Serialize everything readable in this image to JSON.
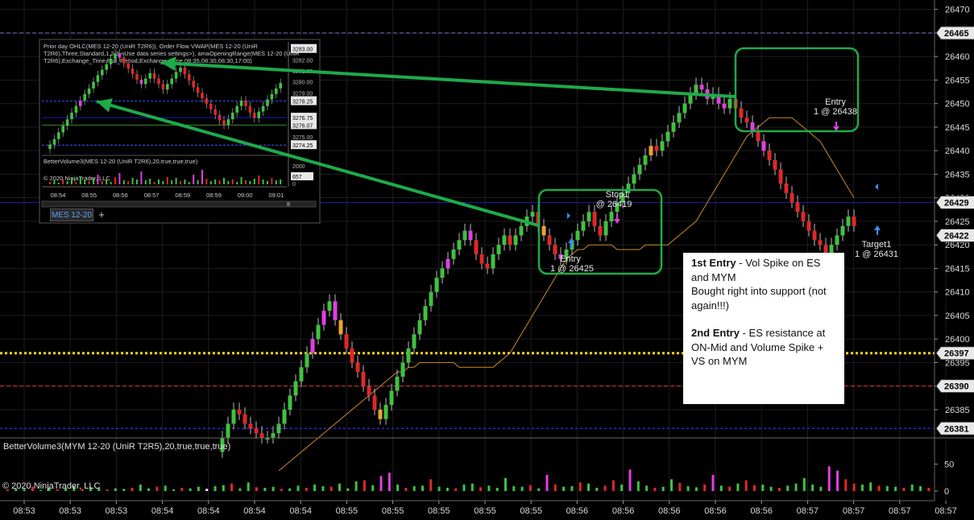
{
  "chart_data": [
    {
      "type": "candlestick",
      "instrument": "MYM 12-20",
      "price_axis": {
        "ylim": [
          26379,
          26472
        ],
        "ticks": [
          26385,
          26390,
          26395,
          26400,
          26405,
          26410,
          26415,
          26420,
          26425,
          26430,
          26435,
          26440,
          26445,
          26450,
          26455,
          26460,
          26465,
          26470
        ],
        "tick_labels": [
          "26385",
          "26390",
          "26395",
          "26400",
          "26405",
          "26410",
          "26415",
          "26420",
          "26425",
          "26430",
          "26435",
          "26440",
          "26445",
          "26450",
          "26455",
          "26460",
          "26465",
          "26470"
        ],
        "boxed_labels": [
          {
            "value": 26465,
            "text": "26465"
          },
          {
            "value": 26429,
            "text": "26429"
          },
          {
            "value": 26422,
            "text": "26422"
          },
          {
            "value": 26397,
            "text": "26397"
          },
          {
            "value": 26390,
            "text": "26390"
          },
          {
            "value": 26381,
            "text": "26381"
          }
        ]
      },
      "time_axis": {
        "labels": [
          "08:53",
          "08:53",
          "08:53",
          "08:54",
          "08:54",
          "08:54",
          "08:54",
          "08:55",
          "08:55",
          "08:55",
          "08:55",
          "08:55",
          "08:56",
          "08:56",
          "08:56",
          "08:56",
          "08:56",
          "08:57",
          "08:57",
          "08:57",
          "08:57"
        ]
      },
      "horizontal_lines": [
        {
          "value": 26465,
          "color": "#8a6fd8",
          "style": "dashed"
        },
        {
          "value": 26429,
          "color": "#1c1c9c",
          "style": "solid"
        },
        {
          "value": 26397,
          "color": "#ffd21e",
          "style": "dotted"
        },
        {
          "value": 26390,
          "color": "#e0303a",
          "style": "dashed"
        },
        {
          "value": 26381,
          "color": "#2a2ad0",
          "style": "dotted"
        }
      ],
      "closes": [
        26379,
        26382,
        26385,
        26384,
        26382,
        26381,
        26380,
        26379,
        26379,
        26380,
        26382,
        26385,
        26388,
        26391,
        26394,
        26397,
        26400,
        26403,
        26406,
        26408,
        26404,
        26401,
        26398,
        26395,
        26393,
        26390,
        26388,
        26385,
        26383,
        26386,
        26389,
        26392,
        26395,
        26398,
        26401,
        26404,
        26407,
        26410,
        26413,
        26415,
        26417,
        26419,
        26421,
        26423,
        26421,
        26418,
        26416,
        26415,
        26418,
        26420,
        26422,
        26420,
        26422,
        26424,
        26426,
        26427,
        26424,
        26422,
        26420,
        26418,
        26417,
        26419,
        26421,
        26423,
        26425,
        26427,
        26424,
        26422,
        26425,
        26427,
        26429,
        26431,
        26433,
        26435,
        26437,
        26439,
        26441,
        26440,
        26442,
        26444,
        26446,
        26448,
        26450,
        26452,
        26454,
        26453,
        26451,
        26452,
        26450,
        26449,
        26451,
        26449,
        26447,
        26446,
        26444,
        26442,
        26440,
        26438,
        26436,
        26433,
        26431,
        26429,
        26427,
        26425,
        26423,
        26421,
        26420,
        26418,
        26420,
        26422,
        26424,
        26426,
        26424
      ],
      "bar_colors_note": "green up, red down, magenta/orange volume-spike bars",
      "bar_special": {
        "16": "magenta",
        "18": "magenta",
        "20": "magenta",
        "21": "orange",
        "28": "orange",
        "40": "magenta",
        "44": "magenta",
        "57": "orange",
        "60": "magenta",
        "76": "orange",
        "85": "magenta",
        "86": "magenta",
        "88": "magenta",
        "89": "magenta",
        "94": "magenta",
        "96": "magenta"
      },
      "vwap": [
        26372,
        26373,
        26374,
        26375,
        26376,
        26377,
        26378,
        26379,
        26380,
        26381,
        26382,
        26383,
        26384,
        26385,
        26386,
        26387,
        26388,
        26389,
        26390,
        26391,
        26392,
        26393,
        26393,
        26394,
        26394,
        26395,
        26395,
        26395,
        26395,
        26395,
        26395,
        26395,
        26394,
        26394,
        26394,
        26394,
        26394,
        26394,
        26394,
        26395,
        26396,
        26397,
        26399,
        26401,
        26403,
        26405,
        26407,
        26409,
        26411,
        26413,
        26415,
        26417,
        26418,
        26419,
        26419,
        26420,
        26420,
        26420,
        26420,
        26420,
        26419,
        26419,
        26419,
        26419,
        26419,
        26420,
        26420,
        26420,
        26420,
        26420,
        26421,
        26422,
        26423,
        26424,
        26425,
        26427,
        26429,
        26431,
        26433,
        26435,
        26437,
        26439,
        26441,
        26443,
        26444,
        26445,
        26446,
        26447,
        26447,
        26447,
        26447,
        26447,
        26446,
        26445,
        26444,
        26443,
        26442,
        26440,
        26438,
        26436,
        26434,
        26432,
        26430
      ],
      "annotations": [
        {
          "kind": "text",
          "text": "Stop1",
          "price": 26421
        },
        {
          "kind": "text",
          "text": "@ 26419",
          "price": 26419
        },
        {
          "kind": "text",
          "text": "Entry",
          "price": 26416
        },
        {
          "kind": "text",
          "text": "1 @ 26425",
          "price": 26414
        },
        {
          "kind": "text",
          "text": "Entry",
          "price": 26450
        },
        {
          "kind": "text",
          "text": "1 @ 26438",
          "price": 26448
        },
        {
          "kind": "text",
          "text": "Target1",
          "price": 26419
        },
        {
          "kind": "text",
          "text": "1 @ 26431",
          "price": 26417
        }
      ],
      "highlight_color": "#1faa4a",
      "arrow_color": "#1faa4a"
    },
    {
      "type": "bar",
      "title": "BetterVolume3(MYM 12-20 (UniR T2R5),20,true,true,true)",
      "yticks": [
        "50",
        "0"
      ],
      "ylim": [
        0,
        75
      ],
      "values": [
        3,
        5,
        4,
        8,
        2,
        6,
        3,
        5,
        9,
        4,
        7,
        6,
        3,
        5,
        4,
        6,
        12,
        5,
        8,
        10,
        3,
        6,
        5,
        8,
        4,
        9,
        11,
        14,
        5,
        16,
        7,
        6,
        8,
        4,
        5,
        10,
        6,
        12,
        9,
        8,
        14,
        5,
        18,
        20,
        11,
        28,
        34,
        12,
        6,
        9,
        10,
        22,
        8,
        6,
        5,
        12,
        14,
        7,
        10,
        6,
        24,
        9,
        8,
        11,
        5,
        30,
        12,
        8,
        9,
        16,
        14,
        6,
        10,
        20,
        12,
        40,
        18,
        10,
        6,
        8,
        22,
        15,
        9,
        7,
        12,
        30,
        10,
        8,
        14,
        20,
        11,
        12,
        8,
        6,
        10,
        14,
        24,
        12,
        8,
        46,
        38,
        22,
        14,
        12,
        16,
        10,
        9,
        8,
        6,
        12,
        9,
        6,
        8,
        5
      ],
      "colors_note": "green up, red down, magenta climax, white low-volume"
    }
  ],
  "inset": {
    "header_line1": "Prior day OHLC(MES 12-20 (UniR T2R6)), Order Flow VWAP(MES 12-20 (UniR",
    "header_line2": "T2R6),Three,Standard,1,2,3,<Use data series settings>), amaOpeningRange(MES 12-20 (UniR",
    "header_line3": "T2R6),Exchange_Time,Full_Period,Exchange_Time,08:35,08:30,08:30,17:00)",
    "price_labels": [
      "3283.00",
      "3282.00",
      "3281.00",
      "3280.00",
      "3279.00",
      "3278.25",
      "3276.75",
      "3276.07",
      "3275.00",
      "3274.25"
    ],
    "volume_title": "BetterVolume3(MES 12-20 (UniR T2R6),20,true,true,true)",
    "volume_labels": [
      "2000",
      "657",
      "0"
    ],
    "copyright": "© 2020 NinjaTrader, LLC",
    "time_labels": [
      "08:54",
      "08:55",
      "08:56",
      "08:57",
      "08:59",
      "08:59",
      "09:00",
      "09:01"
    ],
    "tab_label": "MES 12-20",
    "plus": "+"
  },
  "note": {
    "entry1_bold": "1st Entry",
    "entry1_text": " - Vol Spike on ES and MYM",
    "entry1_text2": "Bought right into support (not again!!!)",
    "entry2_bold": "2nd Entry",
    "entry2_text": " - ES resistance at ON-Mid and Volume Spike + VS on MYM"
  },
  "copyright": "© 2020 NinjaTrader, LLC",
  "colors": {
    "up": "#3fc23f",
    "down": "#e02828",
    "spike": "#e040e0",
    "orange": "#f0a030",
    "vwap": "#d08a20",
    "grid": "#1e1e1e",
    "axis_text": "#d8d8d8"
  }
}
